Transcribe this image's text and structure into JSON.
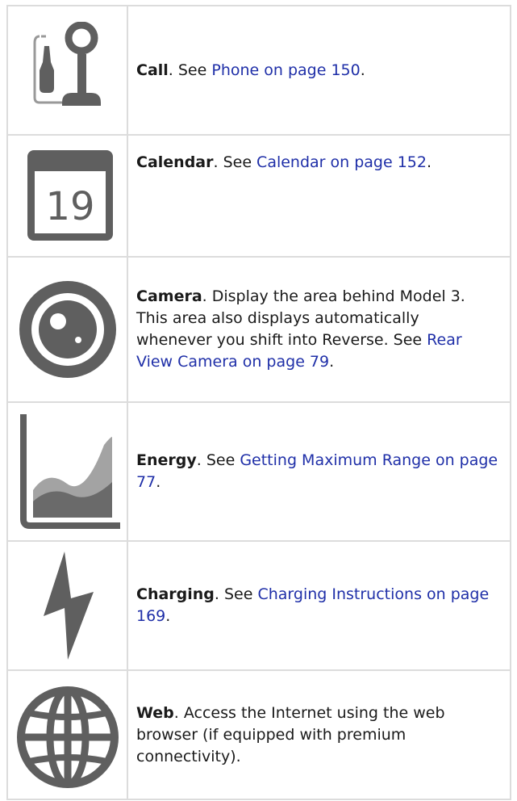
{
  "rows": [
    {
      "icon": "call-icon",
      "term": "Call",
      "text": ". See ",
      "link": "Phone on page 150",
      "tail": "."
    },
    {
      "icon": "calendar-icon",
      "icon_text": "19",
      "term": "Calendar",
      "text": ". See ",
      "link": "Calendar on page 152",
      "tail": "."
    },
    {
      "icon": "camera-icon",
      "term": "Camera",
      "text": ". Display the area behind Model 3. This area also displays automatically whenever you shift into Reverse. See ",
      "link": "Rear View Camera on page 79",
      "tail": "."
    },
    {
      "icon": "energy-icon",
      "term": "Energy",
      "text": ". See ",
      "link": "Getting Maximum Range on page 77",
      "tail": "."
    },
    {
      "icon": "charging-icon",
      "term": "Charging",
      "text": ". See ",
      "link": "Charging Instructions on page 169",
      "tail": "."
    },
    {
      "icon": "web-icon",
      "term": "Web",
      "text": ". Access the Internet using the web browser (if equipped with premium connectivity).",
      "link": "",
      "tail": ""
    }
  ],
  "colors": {
    "icon": "#5f5f5f",
    "link": "#1f2fa8",
    "border": "#dcdcdc"
  }
}
